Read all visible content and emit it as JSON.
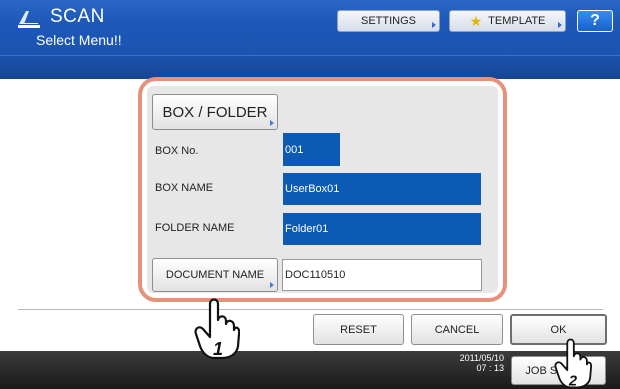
{
  "header": {
    "app_title": "SCAN",
    "subtitle": "Select Menu!!",
    "settings_label": "SETTINGS",
    "template_label": "TEMPLATE",
    "help_label": "?"
  },
  "form": {
    "box_folder_label": "BOX / FOLDER",
    "box_no_label": "BOX No.",
    "box_no_value": "001",
    "box_name_label": "BOX NAME",
    "box_name_value": "UserBox01",
    "folder_name_label": "FOLDER NAME",
    "folder_name_value": "Folder01",
    "document_name_label": "DOCUMENT NAME",
    "document_name_value": "DOC110510"
  },
  "actions": {
    "reset_label": "RESET",
    "cancel_label": "CANCEL",
    "ok_label": "OK"
  },
  "footer": {
    "date": "2011/05/10",
    "time": "07 : 13",
    "job_status_label": "JOB STATUS"
  },
  "callouts": {
    "step1": "1",
    "step2": "2"
  },
  "colors": {
    "header_blue": "#1d58b8",
    "field_blue": "#0d5ab4",
    "highlight": "#e6927a",
    "panel_gray": "#e7e7e7",
    "footer_dark": "#262626"
  },
  "icons": [
    "scan-icon",
    "star-icon",
    "hand-pointer-icon"
  ]
}
